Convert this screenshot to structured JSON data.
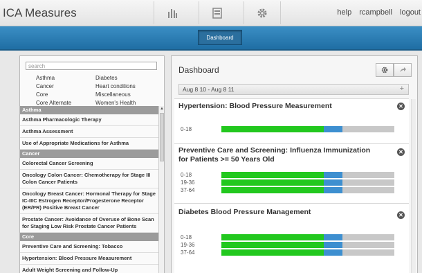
{
  "app": {
    "title": "ICA Measures",
    "links": [
      "help",
      "rcampbell",
      "logout"
    ]
  },
  "nav": {
    "dashboard_label": "Dashboard"
  },
  "search": {
    "placeholder": "search"
  },
  "categories": [
    [
      "Asthma",
      "Diabetes"
    ],
    [
      "Cancer",
      "Heart conditions"
    ],
    [
      "Core",
      "Miscellaneous"
    ],
    [
      "Core Alternate",
      "Women's Health"
    ]
  ],
  "measure_list": [
    {
      "section": "Asthma",
      "items": [
        "Asthma Pharmacologic Therapy",
        "Asthma Assessment",
        "Use of Appropriate Medications for Asthma"
      ]
    },
    {
      "section": "Cancer",
      "items": [
        "Colorectal Cancer Screening",
        "Oncology Colon Cancer: Chemotherapy for Stage III Colon Cancer Patients",
        "Oncology Breast Cancer: Hormonal Therapy for Stage IC-IIIC Estrogen Receptor/Progesterone Receptor (ER/PR) Positive Breast Cancer",
        "Prostate Cancer: Avoidance of Overuse of Bone Scan for Staging Low Risk Prostate Cancer Patients"
      ]
    },
    {
      "section": "Core",
      "items": [
        "Preventive Care and Screening: Tobacco",
        "Hypertension: Blood Pressure Measurement",
        "Adult Weight Screening and Follow-Up"
      ]
    }
  ],
  "dashboard": {
    "title": "Dashboard",
    "date_range": "Aug 8 10 - Aug 8 11",
    "measures": [
      {
        "title": "Hypertension: Blood Pressure Measurement",
        "rows": [
          {
            "label": "0-18",
            "green": 0.59,
            "blue": 0.11
          }
        ]
      },
      {
        "title": "Preventive Care and Screening: Influenza Immunization for Patients >= 50 Years Old",
        "rows": [
          {
            "label": "0-18",
            "green": 0.59,
            "blue": 0.11
          },
          {
            "label": "19-36",
            "green": 0.59,
            "blue": 0.11
          },
          {
            "label": "37-64",
            "green": 0.59,
            "blue": 0.11
          }
        ]
      },
      {
        "title": "Diabetes Blood Pressure Management",
        "rows": [
          {
            "label": "0-18",
            "green": 0.59,
            "blue": 0.11
          },
          {
            "label": "19-36",
            "green": 0.59,
            "blue": 0.11
          },
          {
            "label": "37-64",
            "green": 0.59,
            "blue": 0.11
          }
        ]
      }
    ]
  },
  "colors": {
    "nav_blue": "#2a7bb3",
    "bar_green": "#22c81e",
    "bar_blue": "#3d8fd0",
    "bar_gray": "#c8c8c8"
  },
  "icons": [
    "bar-chart-icon",
    "document-icon",
    "gear-icon",
    "close-icon",
    "share-icon",
    "plus-icon"
  ]
}
